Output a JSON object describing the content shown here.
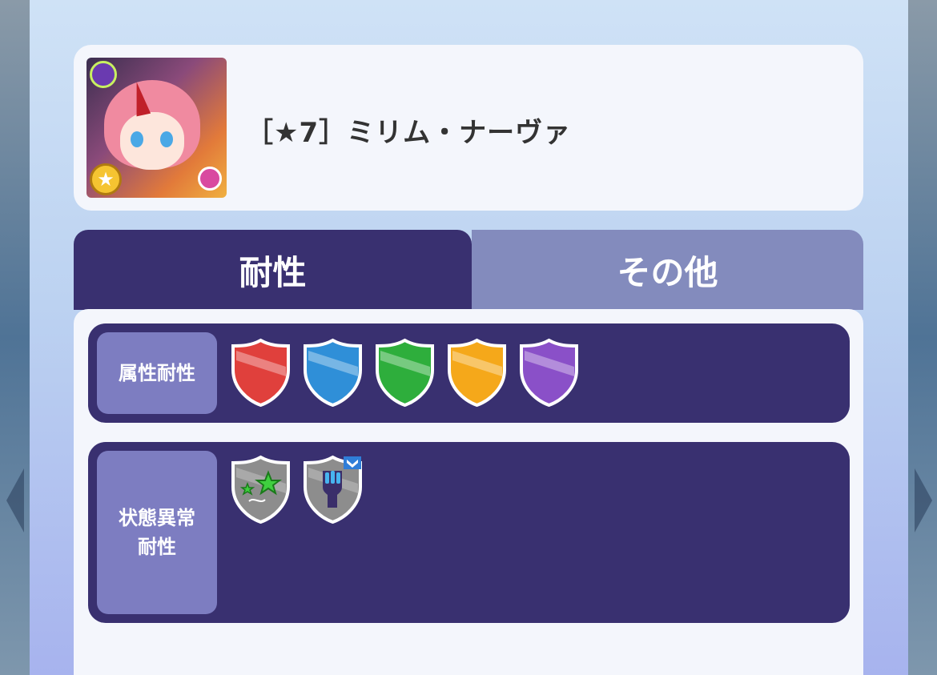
{
  "character": {
    "name": "［★7］ミリム・ナーヴァ",
    "rank_badge_icon": "star-icon"
  },
  "tabs": [
    {
      "label": "耐性",
      "active": true
    },
    {
      "label": "その他",
      "active": false
    }
  ],
  "resistance": {
    "attribute": {
      "label": "属性耐性",
      "shields": [
        {
          "icon": "fire-resist-shield-icon",
          "color": "#e0403c"
        },
        {
          "icon": "water-resist-shield-icon",
          "color": "#2f8fd8"
        },
        {
          "icon": "wind-resist-shield-icon",
          "color": "#2eae3c"
        },
        {
          "icon": "light-resist-shield-icon",
          "color": "#f5a81a"
        },
        {
          "icon": "dark-resist-shield-icon",
          "color": "#8a50c8"
        }
      ]
    },
    "status_ailment": {
      "label_line1": "状態異常",
      "label_line2": "耐性",
      "shields": [
        {
          "icon": "stun-resist-shield-icon"
        },
        {
          "icon": "bind-resist-shield-icon"
        }
      ]
    }
  }
}
